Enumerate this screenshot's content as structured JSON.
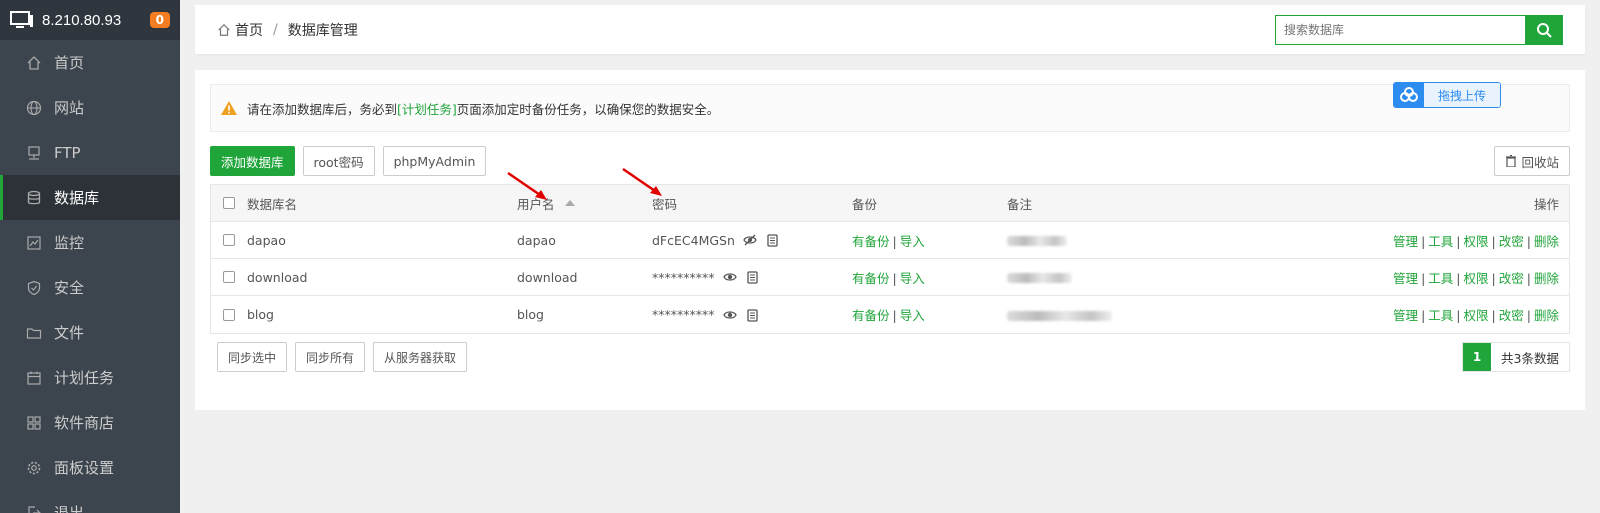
{
  "server": {
    "ip": "8.210.80.93",
    "badge": "0"
  },
  "sidebar": {
    "items": [
      {
        "label": "首页",
        "icon": "home-icon"
      },
      {
        "label": "网站",
        "icon": "globe-icon"
      },
      {
        "label": "FTP",
        "icon": "ftp-icon"
      },
      {
        "label": "数据库",
        "icon": "database-icon",
        "active": true
      },
      {
        "label": "监控",
        "icon": "monitor-chart-icon"
      },
      {
        "label": "安全",
        "icon": "shield-icon"
      },
      {
        "label": "文件",
        "icon": "folder-icon"
      },
      {
        "label": "计划任务",
        "icon": "calendar-icon"
      },
      {
        "label": "软件商店",
        "icon": "grid-apps-icon"
      },
      {
        "label": "面板设置",
        "icon": "gear-icon"
      },
      {
        "label": "退出",
        "icon": "logout-icon"
      }
    ]
  },
  "header": {
    "breadcrumb_home": "首页",
    "breadcrumb_sep": "/",
    "breadcrumb_current": "数据库管理",
    "search_placeholder": "搜索数据库"
  },
  "notice": {
    "text_before": "请在添加数据库后，务必到",
    "link": "[计划任务]",
    "text_after": "页面添加定时备份任务，以确保您的数据安全。"
  },
  "upload_label": "拖拽上传",
  "toolbar": {
    "add": "添加数据库",
    "root_password": "root密码",
    "phpmyadmin": "phpMyAdmin",
    "recycle": "回收站"
  },
  "table": {
    "headers": {
      "name": "数据库名",
      "user": "用户名",
      "password": "密码",
      "backup": "备份",
      "note": "备注",
      "ops": "操作"
    },
    "rows": [
      {
        "name": "dapao",
        "user": "dapao",
        "password": "dFcEC4MGSn",
        "password_visible": true,
        "backup_link": "有备份",
        "import_link": "导入"
      },
      {
        "name": "download",
        "user": "download",
        "password": "**********",
        "password_visible": false,
        "backup_link": "有备份",
        "import_link": "导入"
      },
      {
        "name": "blog",
        "user": "blog",
        "password": "**********",
        "password_visible": false,
        "backup_link": "有备份",
        "import_link": "导入"
      }
    ],
    "ops": {
      "manage": "管理",
      "tools": "工具",
      "perms": "权限",
      "change_pw": "改密",
      "delete": "删除"
    },
    "sep": "|"
  },
  "footer": {
    "sync_selected": "同步选中",
    "sync_all": "同步所有",
    "fetch_server": "从服务器获取",
    "page": "1",
    "total": "共3条数据"
  },
  "colors": {
    "accent": "#20a53a",
    "sidebar": "#3c444d",
    "warning": "#f0a020",
    "annotation_arrow": "#e00000"
  }
}
